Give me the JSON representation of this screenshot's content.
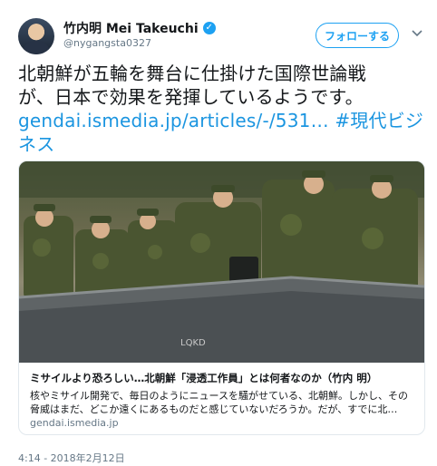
{
  "author": {
    "display_name": "竹内明 Mei Takeuchi",
    "handle": "@nygangsta0327",
    "verified_mark": "✓"
  },
  "follow_button": {
    "label": "フォローする"
  },
  "more_icon": "chevron-down-icon",
  "tweet": {
    "text_line1": "北朝鮮が五輪を舞台に仕掛けた国際世論戦",
    "text_line2": "が、日本で効果を発揮しているようです。",
    "link": "gendai.ismedia.jp/articles/-/531…",
    "hashtag_a": " #現代ビジ",
    "hashtag_b": "ネス"
  },
  "card": {
    "title": "ミサイルより恐ろしい…北朝鮮「浸透工作員」とは何者なのか（竹内 明）",
    "description": "核やミサイル開発で、毎日のようにニュースを騒がせている、北朝鮮。しかし、その脅威はまだ、どこか遠くにあるものだと感じていないだろうか。だが、すでに北…",
    "domain": "gendai.ismedia.jp",
    "image_text": "LQKD"
  },
  "timestamp": "4:14 - 2018年2月12日",
  "colors": {
    "accent": "#1da1f2",
    "link": "#1b95e0",
    "muted": "#657786",
    "border": "#e1e8ed"
  }
}
